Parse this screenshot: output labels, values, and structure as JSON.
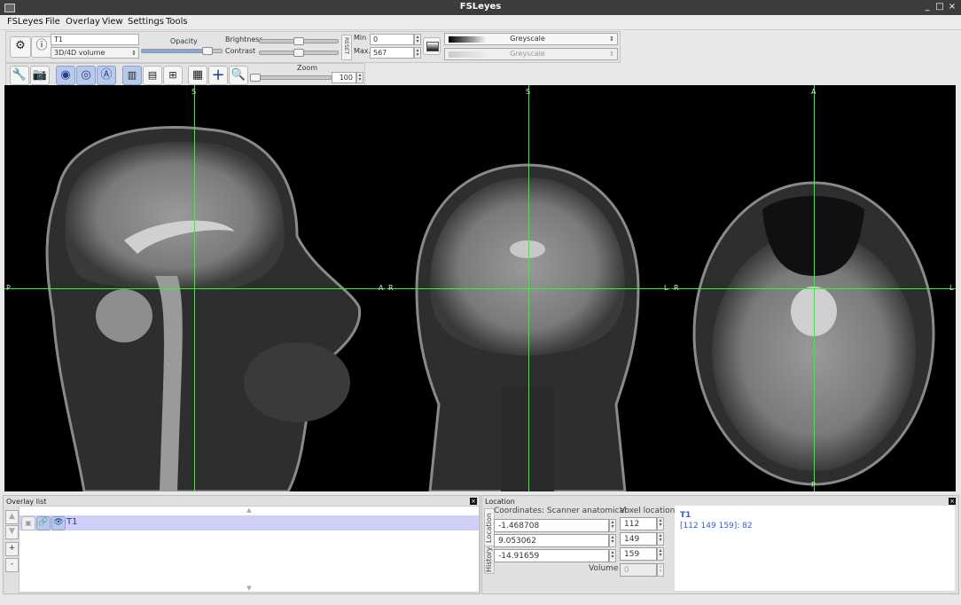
{
  "window": {
    "title": "FSLeyes"
  },
  "menu": [
    "FSLeyes",
    "File",
    "Overlay",
    "View",
    "Settings",
    "Tools"
  ],
  "overlay_toolbar": {
    "name_value": "T1",
    "type_value": "3D/4D volume",
    "opacity_label": "Opacity",
    "brightness_label": "Brightness",
    "contrast_label": "Contrast",
    "reset_label": "RESET",
    "min_label": "Min",
    "max_label": "Max.",
    "min_value": "0",
    "max_value": "567",
    "cmap_value": "Greyscale",
    "neg_cmap_value": "Greyscale",
    "opacity_level": 0.86,
    "brightness_level": 0.5,
    "contrast_level": 0.5
  },
  "ortho_toolbar": {
    "zoom_label": "Zoom",
    "zoom_value": "100",
    "zoom_level": 0.0
  },
  "viewer": {
    "sagittal": {
      "top": "S",
      "left": "P",
      "right": "A"
    },
    "coronal": {
      "top": "S",
      "left": "R",
      "right": "L"
    },
    "axial": {
      "top": "A",
      "bottom": "P",
      "left": "R",
      "right": "L"
    }
  },
  "overlay_list": {
    "title": "Overlay list",
    "items": [
      {
        "name": "T1"
      }
    ],
    "buttons": [
      "+",
      "-"
    ]
  },
  "location": {
    "title": "Location",
    "tab_location": "Location",
    "tab_history": "History",
    "coords_label": "Coordinates: Scanner anatomical",
    "voxel_label": "Voxel location",
    "coords": [
      "-1.468708",
      "9.053062",
      "-14.91659"
    ],
    "voxels": [
      "112",
      "149",
      "159"
    ],
    "volume_label": "Volume",
    "volume_value": "0",
    "info_name": "T1",
    "info_value": "[112 149 159]: 82"
  },
  "colors": {
    "crosshair": "#22ff22",
    "info": "#3a5bd0",
    "selected_row": "#cfcff7"
  }
}
